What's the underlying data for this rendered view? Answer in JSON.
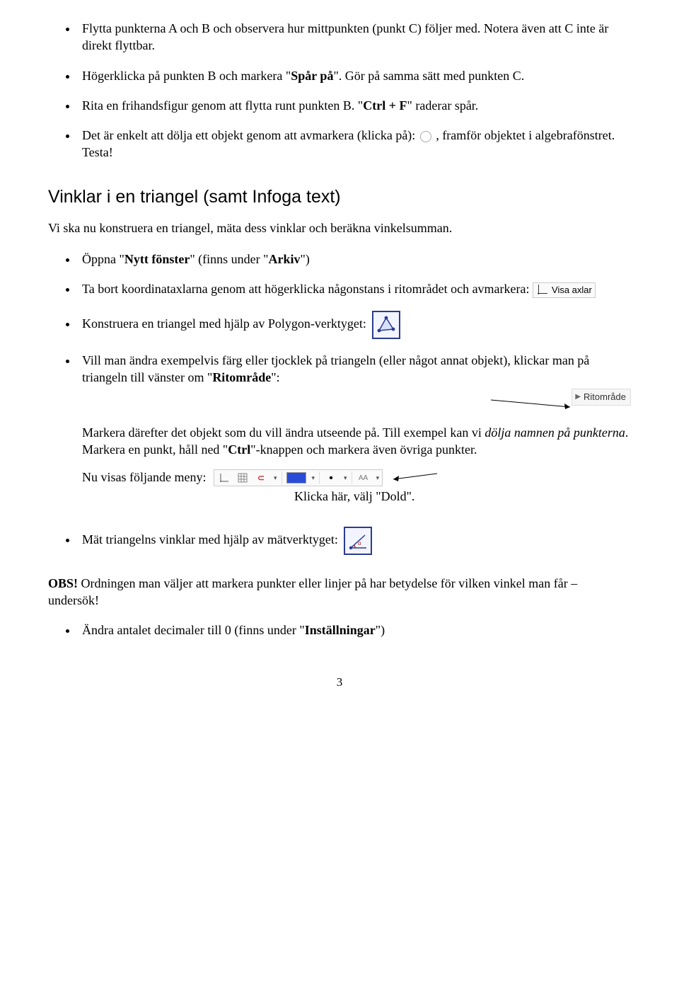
{
  "bullets_top": [
    {
      "pre": "Flytta punkterna A och B och observera hur mittpunkten (punkt C) följer med. Notera även att C inte är direkt flyttbar."
    },
    {
      "pre": "Högerklicka på punkten B och markera \"",
      "bold": "Spår på",
      "post": "\". Gör på samma sätt med punkten C."
    },
    {
      "pre": "Rita en frihandsfigur genom att flytta runt punkten B. \"",
      "bold": "Ctrl + F",
      "post": "\" raderar spår."
    },
    {
      "pre": "Det är enkelt att dölja ett objekt genom att avmarkera (klicka på): ",
      "icon": "visibility-dot",
      "post": " , framför objektet i algebrafönstret. Testa!"
    }
  ],
  "heading": "Vinklar i en triangel (samt Infoga text)",
  "lead": "Vi ska nu konstruera en triangel, mäta dess vinklar och beräkna vinkelsumman.",
  "bullets_mid": {
    "b1_pre": "Öppna \"",
    "b1_b1": "Nytt fönster",
    "b1_mid": "\" (finns under \"",
    "b1_b2": "Arkiv",
    "b1_post": "\")",
    "b2_pre": "Ta bort koordinataxlarna genom att högerklicka någonstans i ritområdet och avmarkera:",
    "visa_axlar_label": "Visa axlar",
    "b3_text": "Konstruera en triangel med hjälp av Polygon-verktyget:",
    "b4_pre": "Vill man ändra exempelvis färg eller tjocklek på triangeln (eller något annat objekt), klickar man på triangeln till vänster om \"",
    "b4_bold": "Ritområde",
    "b4_post": "\":",
    "ritomrade_chip": "Ritområde",
    "b4_para2_pre": "Markera därefter det objekt som du vill ändra utseende på. Till exempel kan vi ",
    "b4_para2_ital": "dölja namnen på punkterna",
    "b4_para2_mid": ". Markera en punkt, håll ned \"",
    "b4_para2_bold": "Ctrl",
    "b4_para2_post": "\"-knappen och markera även övriga punkter.",
    "b4_menu_pre": "Nu visas följande meny:",
    "toolbar_aa": "AA",
    "klicka_text": "Klicka här, välj \"Dold\".",
    "b5_text": "Mät triangelns vinklar med hjälp av mätverktyget:"
  },
  "obs": {
    "label": "OBS!",
    "text": " Ordningen man väljer att markera punkter eller linjer på har betydelse för vilken vinkel man får – undersök!"
  },
  "bullets_end": {
    "pre": "Ändra antalet decimaler till 0 (finns under \"",
    "bold": "Inställningar",
    "post": "\")"
  },
  "page_number": "3"
}
